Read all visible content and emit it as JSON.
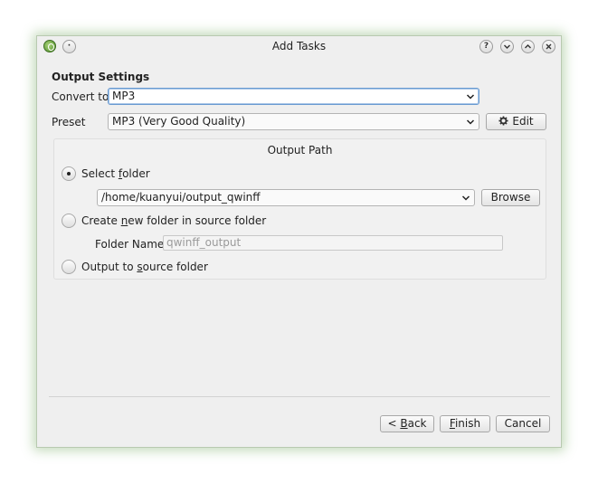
{
  "window": {
    "title": "Add Tasks",
    "titlebar_buttons": [
      "?",
      "⌄",
      "⌃",
      "✕"
    ]
  },
  "output_settings": {
    "heading": "Output Settings",
    "convert_to_label": "Convert to",
    "convert_to_value": "MP3",
    "preset_label": "Preset",
    "preset_value": "MP3 (Very Good Quality)",
    "edit_label": "Edit"
  },
  "output_path": {
    "heading": "Output Path",
    "select_folder_pre": "Select ",
    "select_folder_u": "f",
    "select_folder_post": "older",
    "select_folder_checked": true,
    "folder_value": "/home/kuanyui/output_qwinff",
    "browse_label": "Browse",
    "create_new_pre": "Create ",
    "create_new_u": "n",
    "create_new_post": "ew folder in source folder",
    "folder_name_label": "Folder Name",
    "folder_name_placeholder": "qwinff_output",
    "output_source_pre": "Output to ",
    "output_source_u": "s",
    "output_source_post": "ource folder"
  },
  "footer": {
    "back_pre": "< ",
    "back_u": "B",
    "back_post": "ack",
    "finish_u": "F",
    "finish_post": "inish",
    "cancel_label": "Cancel"
  }
}
